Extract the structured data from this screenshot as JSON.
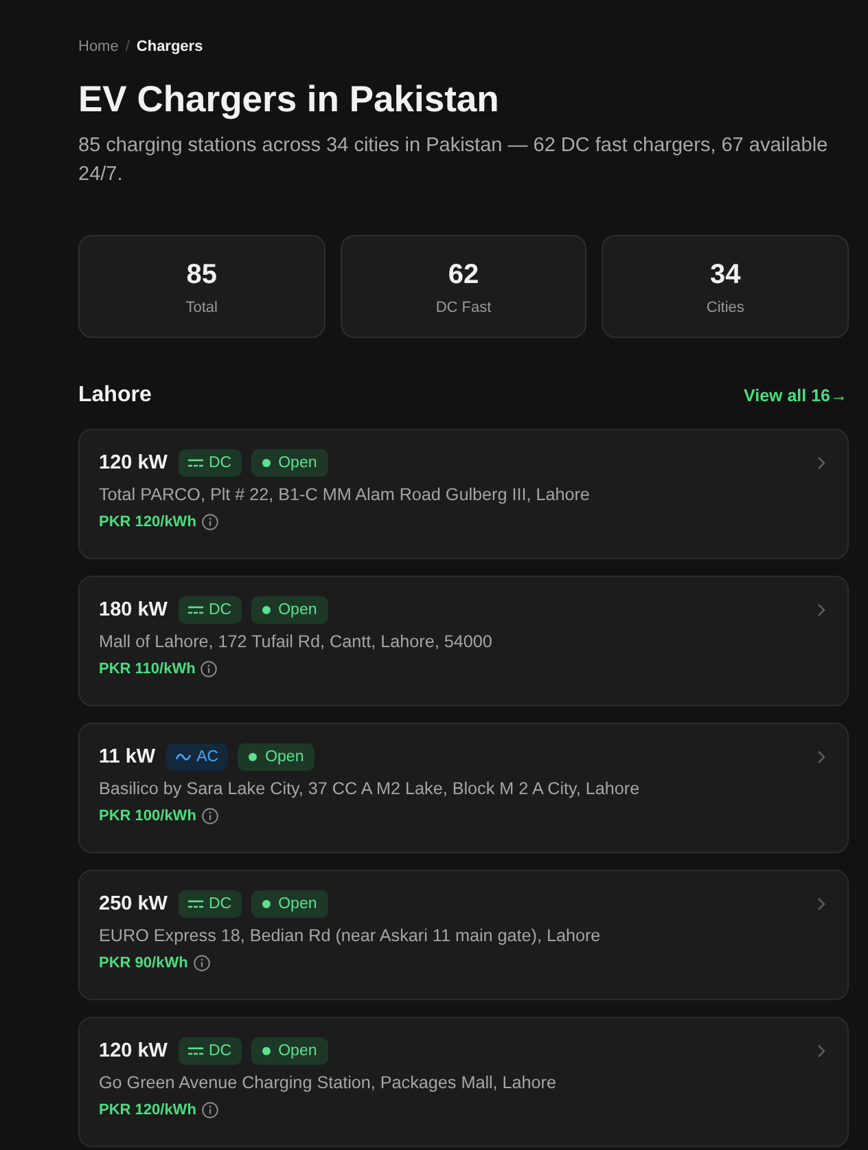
{
  "breadcrumb": {
    "items": [
      {
        "label": "Home",
        "current": false
      },
      {
        "label": "Chargers",
        "current": true
      }
    ],
    "separator": "/"
  },
  "title": "EV Chargers in Pakistan",
  "description": "85 charging stations across 34 cities in Pakistan — 62 DC fast chargers, 67 available 24/7.",
  "stats": [
    {
      "value": "85",
      "label": "Total"
    },
    {
      "value": "62",
      "label": "DC Fast"
    },
    {
      "value": "34",
      "label": "Cities"
    }
  ],
  "section": {
    "title": "Lahore",
    "link": "View all 16→"
  },
  "chargers": [
    {
      "power": "120 kW",
      "current": {
        "label": "DC",
        "kind": "dc"
      },
      "status": {
        "label": "Open",
        "open": true
      },
      "address": "Total PARCO, Plt # 22, B1-C MM Alam Road Gulberg III, Lahore",
      "price": "PKR 120/kWh"
    },
    {
      "power": "180 kW",
      "current": {
        "label": "DC",
        "kind": "dc"
      },
      "status": {
        "label": "Open",
        "open": true
      },
      "address": "Mall of Lahore, 172 Tufail Rd, Cantt, Lahore, 54000",
      "price": "PKR 110/kWh"
    },
    {
      "power": "11 kW",
      "current": {
        "label": "AC",
        "kind": "ac"
      },
      "status": {
        "label": "Open",
        "open": true
      },
      "address": "Basilico by Sara Lake City, 37 CC A M2 Lake, Block M 2 A City, Lahore",
      "price": "PKR 100/kWh"
    },
    {
      "power": "250 kW",
      "current": {
        "label": "DC",
        "kind": "dc"
      },
      "status": {
        "label": "Open",
        "open": true
      },
      "address": "EURO Express 18, Bedian Rd (near Askari 11 main gate), Lahore",
      "price": "PKR 90/kWh"
    },
    {
      "power": "120 kW",
      "current": {
        "label": "DC",
        "kind": "dc"
      },
      "status": {
        "label": "Open",
        "open": true
      },
      "address": "Go Green Avenue Charging Station, Packages Mall, Lahore",
      "price": "PKR 120/kWh"
    }
  ]
}
